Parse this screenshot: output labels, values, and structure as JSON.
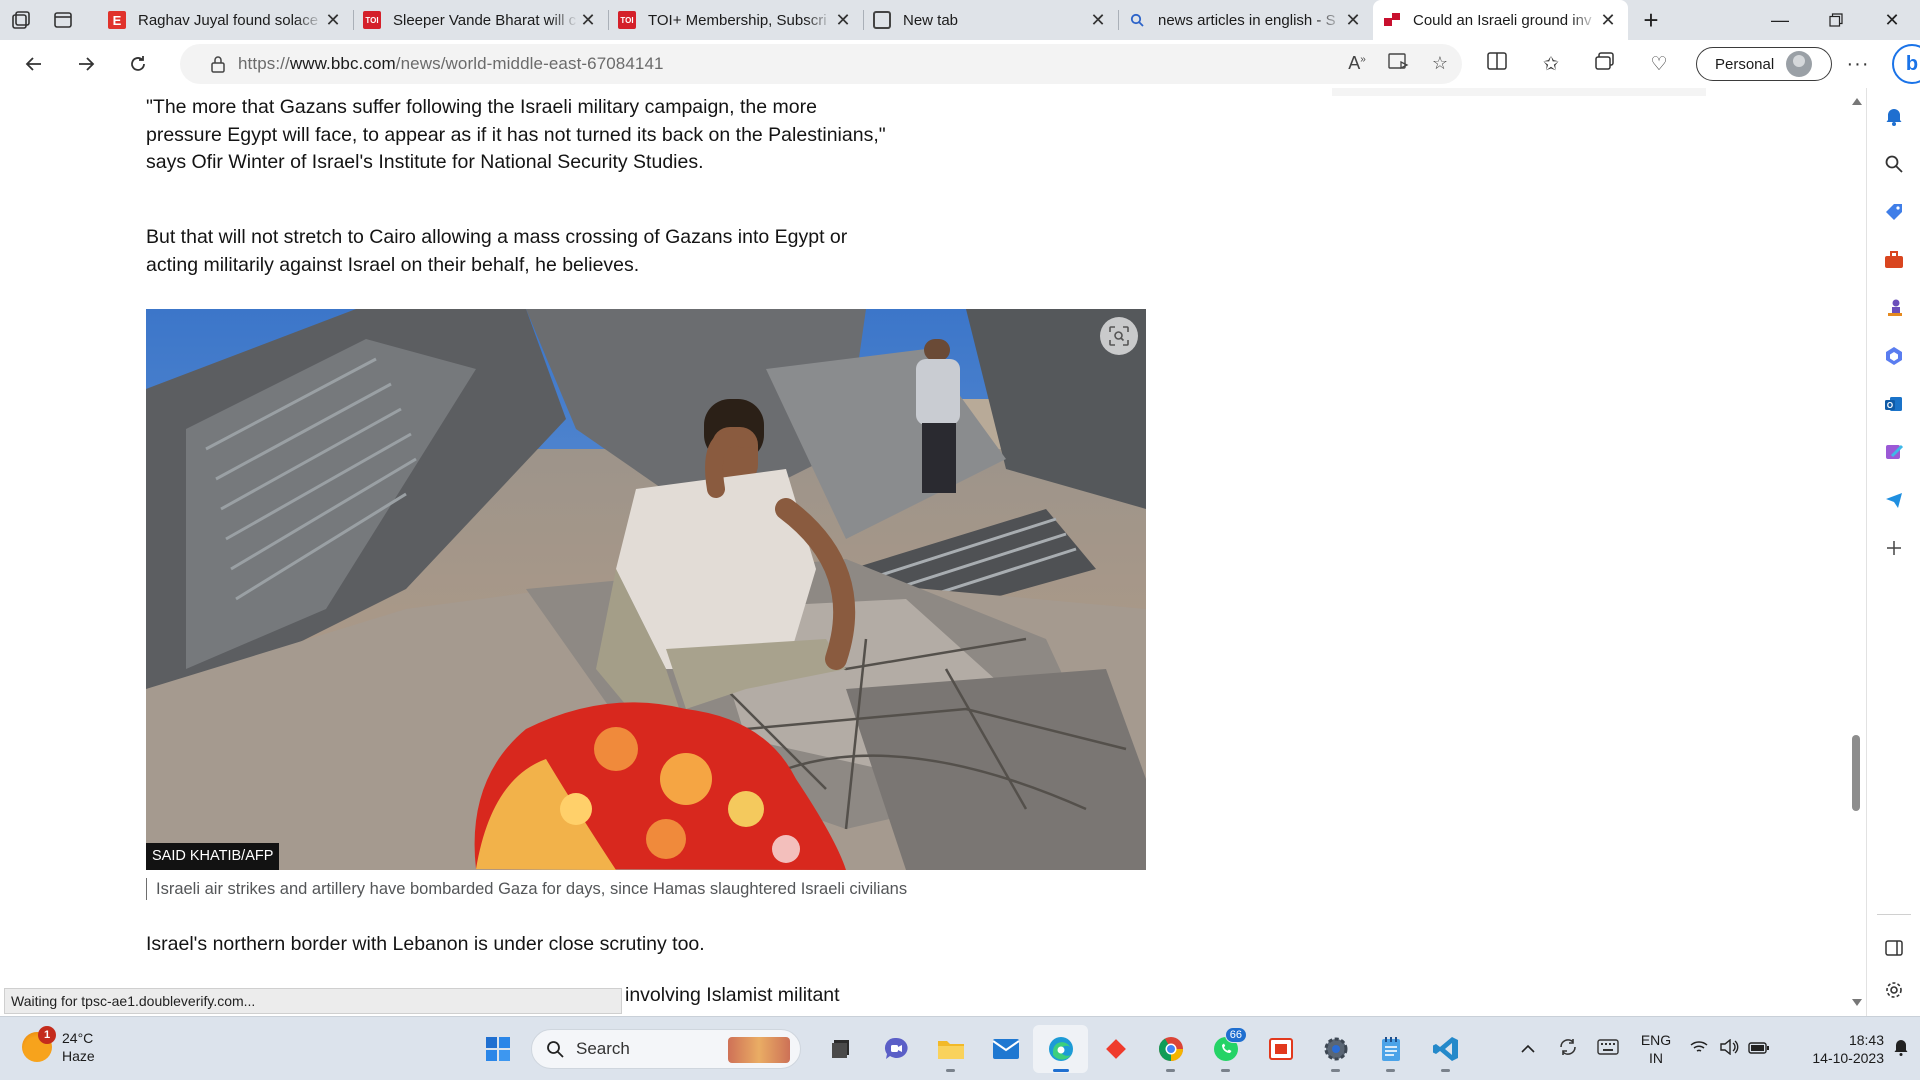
{
  "browser": {
    "tabs": [
      {
        "title": "Raghav Juyal found solace",
        "favicon": "e-letter-icon"
      },
      {
        "title": "Sleeper Vande Bharat will c",
        "favicon": "toi-icon",
        "favicon_text": "TOI"
      },
      {
        "title": "TOI+ Membership, Subscri",
        "favicon": "toi-icon",
        "favicon_text": "TOI"
      },
      {
        "title": "New tab",
        "favicon": "newtab-icon"
      },
      {
        "title": "news articles in english - S",
        "favicon": "search-icon"
      },
      {
        "title": "Could an Israeli ground inv",
        "favicon": "bbc-icon",
        "active": true
      }
    ],
    "url_prefix": "https://",
    "url_host": "www.bbc.com",
    "url_path": "/news/world-middle-east-67084141",
    "profile_label": "Personal",
    "status_text": "Waiting for tpsc-ae1.doubleverify.com..."
  },
  "article": {
    "paragraphs_top": [
      "\"The more that Gazans suffer following the Israeli military campaign, the more pressure Egypt will face, to appear as if it has not turned its back on the Palestinians,\" says Ofir Winter of Israel's Institute for National Security Studies.",
      "But that will not stretch to Cairo allowing a mass crossing of Gazans into Egypt or acting militarily against Israel on their behalf, he believes."
    ],
    "image_credit": "SAID KHATIB/AFP",
    "caption": "Israeli air strikes and artillery have bombarded Gaza for days, since Hamas slaughtered Israeli civilians",
    "paragraph_after": "Israel's northern border with Lebanon is under close scrutiny too.",
    "paragraph_partial": "involving Islamist militant"
  },
  "taskbar": {
    "weather_temp": "24°C",
    "weather_desc": "Haze",
    "weather_badge": "1",
    "search_placeholder": "Search",
    "whatsapp_badge": "66",
    "lang_primary": "ENG",
    "lang_secondary": "IN",
    "time": "18:43",
    "date": "14-10-2023"
  },
  "colors": {
    "bbc_red": "#c8102e",
    "accent_blue": "#1f6fd0"
  }
}
